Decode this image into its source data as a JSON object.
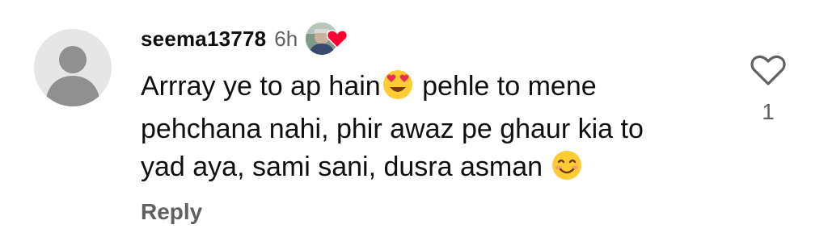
{
  "comment": {
    "username": "seema13778",
    "time": "6h",
    "text_line1_part1": "Arrray ye to ap hain",
    "emoji1": "heart-eyes-emoji",
    "text_line1_part2": " pehle to mene",
    "text_line2": "pehchana nahi, phir awaz pe ghaur kia to",
    "text_line3": "yad aya, sami sani, dusra asman ",
    "emoji2": "smiling-face-emoji",
    "reply_label": "Reply",
    "like_count": "1",
    "creator_heart": true
  },
  "colors": {
    "secondary_text": "#606060",
    "heart_red": "#ff0033",
    "avatar_bg": "#e6e6e6",
    "avatar_figure": "#909090",
    "emoji_yellow": "#ffcc33"
  }
}
